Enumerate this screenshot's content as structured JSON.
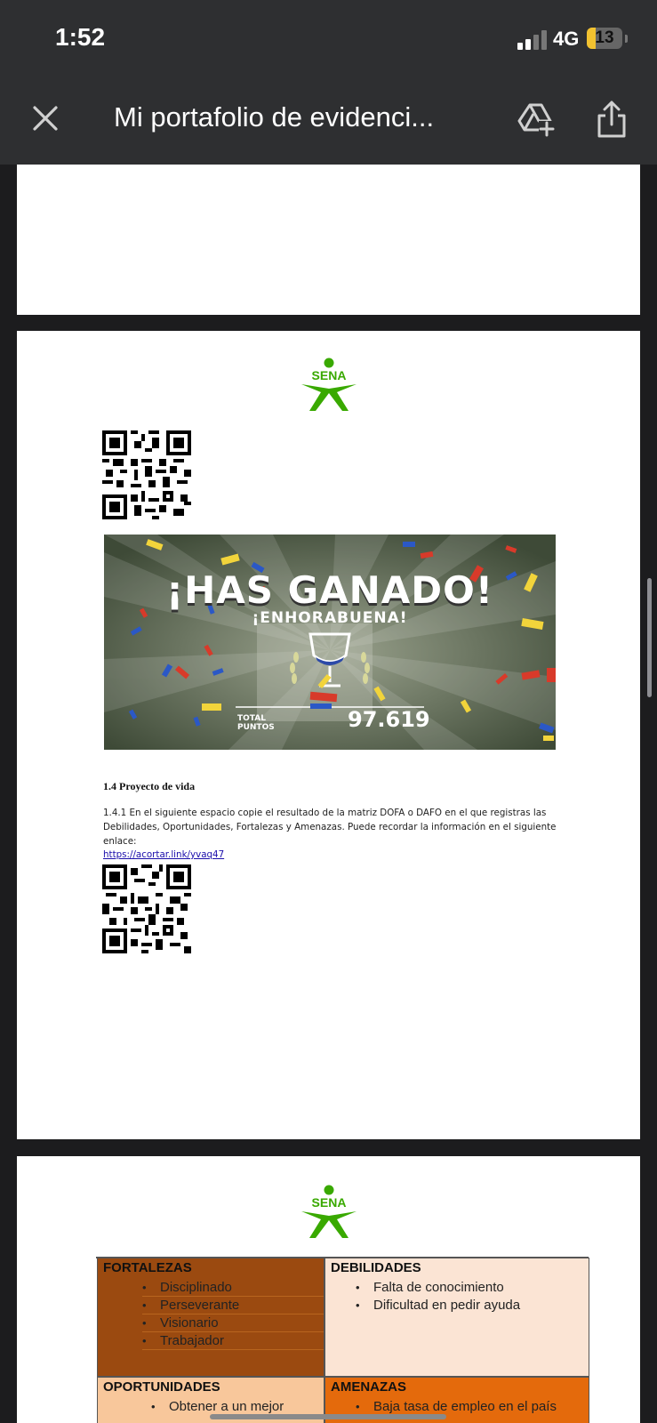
{
  "status_bar": {
    "time": "1:52",
    "network": "4G",
    "battery": "13"
  },
  "header": {
    "title": "Mi portafolio de evidenci..."
  },
  "banner": {
    "headline": "¡HAS GANADO!",
    "subheadline": "¡ENHORABUENA!",
    "total_label_1": "TOTAL",
    "total_label_2": "PUNTOS",
    "points": "97.619"
  },
  "logo": {
    "text": "SENA"
  },
  "section": {
    "title": "1.4 Proyecto de vida",
    "text": "1.4.1 En el siguiente espacio copie el resultado de la matriz DOFA o DAFO en el que registras las Debilidades, Oportunidades, Fortalezas y Amenazas. Puede recordar la información en el siguiente enlace:",
    "link": "https://acortar.link/yvaq47"
  },
  "dofa": {
    "fortalezas": {
      "title": "FORTALEZAS",
      "items": [
        "Disciplinado",
        "Perseverante",
        "Visionario",
        "Trabajador"
      ]
    },
    "debilidades": {
      "title": "DEBILIDADES",
      "items": [
        "Falta de conocimiento",
        "Dificultad en pedir ayuda"
      ]
    },
    "oportunidades": {
      "title": "OPORTUNIDADES",
      "items": [
        "Obtener a un mejor"
      ]
    },
    "amenazas": {
      "title": "AMENAZAS",
      "items": [
        "Baja tasa de empleo en el país"
      ]
    }
  },
  "colors": {
    "sena_green": "#39a900",
    "fortalezas": "#9b4a10",
    "debilidades": "#fbe4d4",
    "oportunidades": "#f8c79b",
    "amenazas": "#e46a0c"
  }
}
